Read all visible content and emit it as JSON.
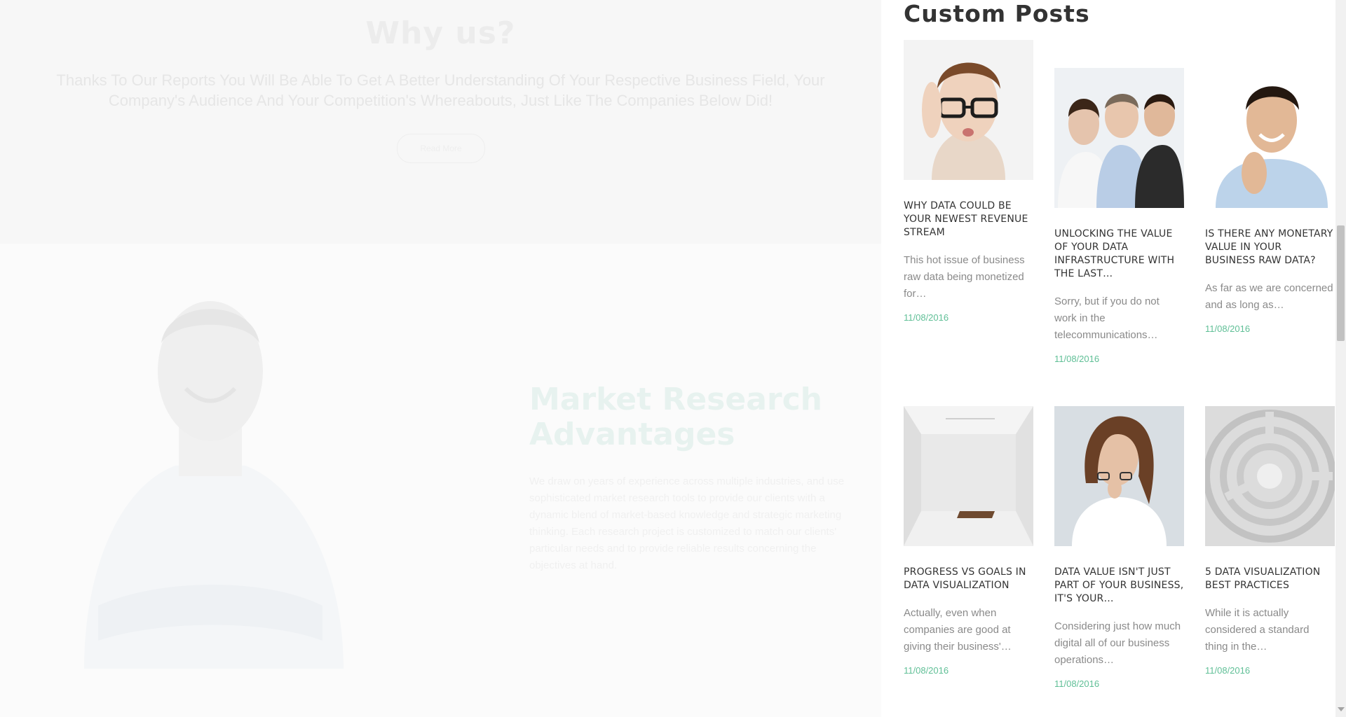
{
  "why_section": {
    "title": "Why us?",
    "text": "Thanks To Our Reports You Will Be Able To Get A Better Understanding Of  Your Respective Business Field, Your Company's Audience And Your Competition's Whereabouts, Just Like The Companies Below Did!",
    "button_label": "Read More"
  },
  "advantages_section": {
    "title": "Market Research Advantages",
    "text": "We draw on years of experience across multiple industries, and use sophisticated market research tools to provide our clients with a dynamic blend of market-based knowledge and strategic marketing thinking. Each research project is customized to match our clients' particular needs and to provide reliable results concerning the objectives at hand."
  },
  "custom_posts": {
    "title": "Custom Posts",
    "posts": [
      {
        "title": "WHY DATA COULD BE YOUR NEWEST REVENUE STREAM",
        "excerpt": "This hot issue of business raw data being monetized for…",
        "date": "11/08/2016",
        "image": "woman-glasses-photo"
      },
      {
        "title": "UNLOCKING THE VALUE OF YOUR DATA INFRASTRUCTURE WITH THE LAST…",
        "excerpt": "Sorry, but if you do not work in the telecommunications…",
        "date": "11/08/2016",
        "image": "group-people-photo"
      },
      {
        "title": "IS THERE ANY MONETARY VALUE IN YOUR BUSINESS RAW DATA?",
        "excerpt": "As far as we are concerned and as long as…",
        "date": "11/08/2016",
        "image": "smiling-man-photo"
      },
      {
        "title": "PROGRESS VS GOALS IN DATA VISUALIZATION",
        "excerpt": "Actually, even when companies are good at giving their business'…",
        "date": "11/08/2016",
        "image": "empty-gallery-photo"
      },
      {
        "title": "DATA VALUE ISN'T JUST PART OF YOUR BUSINESS, IT'S YOUR…",
        "excerpt": "Considering just how much digital all of our business operations…",
        "date": "11/08/2016",
        "image": "woman-glasses-chin-photo"
      },
      {
        "title": "5 DATA VISUALIZATION BEST PRACTICES",
        "excerpt": "While it is actually considered a standard thing in the…",
        "date": "11/08/2016",
        "image": "maze-photo"
      }
    ]
  },
  "colors": {
    "accent": "#5fbf96",
    "heading": "#333333",
    "body": "#8a8a8a"
  }
}
